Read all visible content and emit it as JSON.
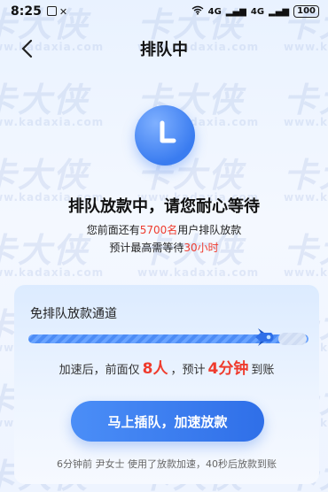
{
  "status_bar": {
    "time": "8:25",
    "network_1": "4G",
    "network_2": "4G",
    "battery": "100"
  },
  "nav": {
    "title": "排队中"
  },
  "queue": {
    "headline": "排队放款中，请您耐心等待",
    "ahead_prefix": "您前面还有",
    "ahead_count": "5700名",
    "ahead_suffix": "用户排队放款",
    "wait_prefix": "预计最高需等待",
    "wait_time": "30小时"
  },
  "fast_lane": {
    "title": "免排队放款通道",
    "progress": 0.9,
    "accel_prefix": "加速后，前面仅",
    "accel_count": "8人",
    "accel_mid": "，预计",
    "accel_time": "4分钟",
    "accel_suffix": "到账",
    "button_label": "马上插队，加速放款",
    "footer_note": "6分钟前 尹女士 使用了放款加速，40秒后放款到账"
  },
  "watermark": {
    "brand": "卡大侠",
    "url": "www.kadaxia.com"
  },
  "colors": {
    "accent": "#3a7cf0",
    "highlight": "#ef3b2d"
  }
}
